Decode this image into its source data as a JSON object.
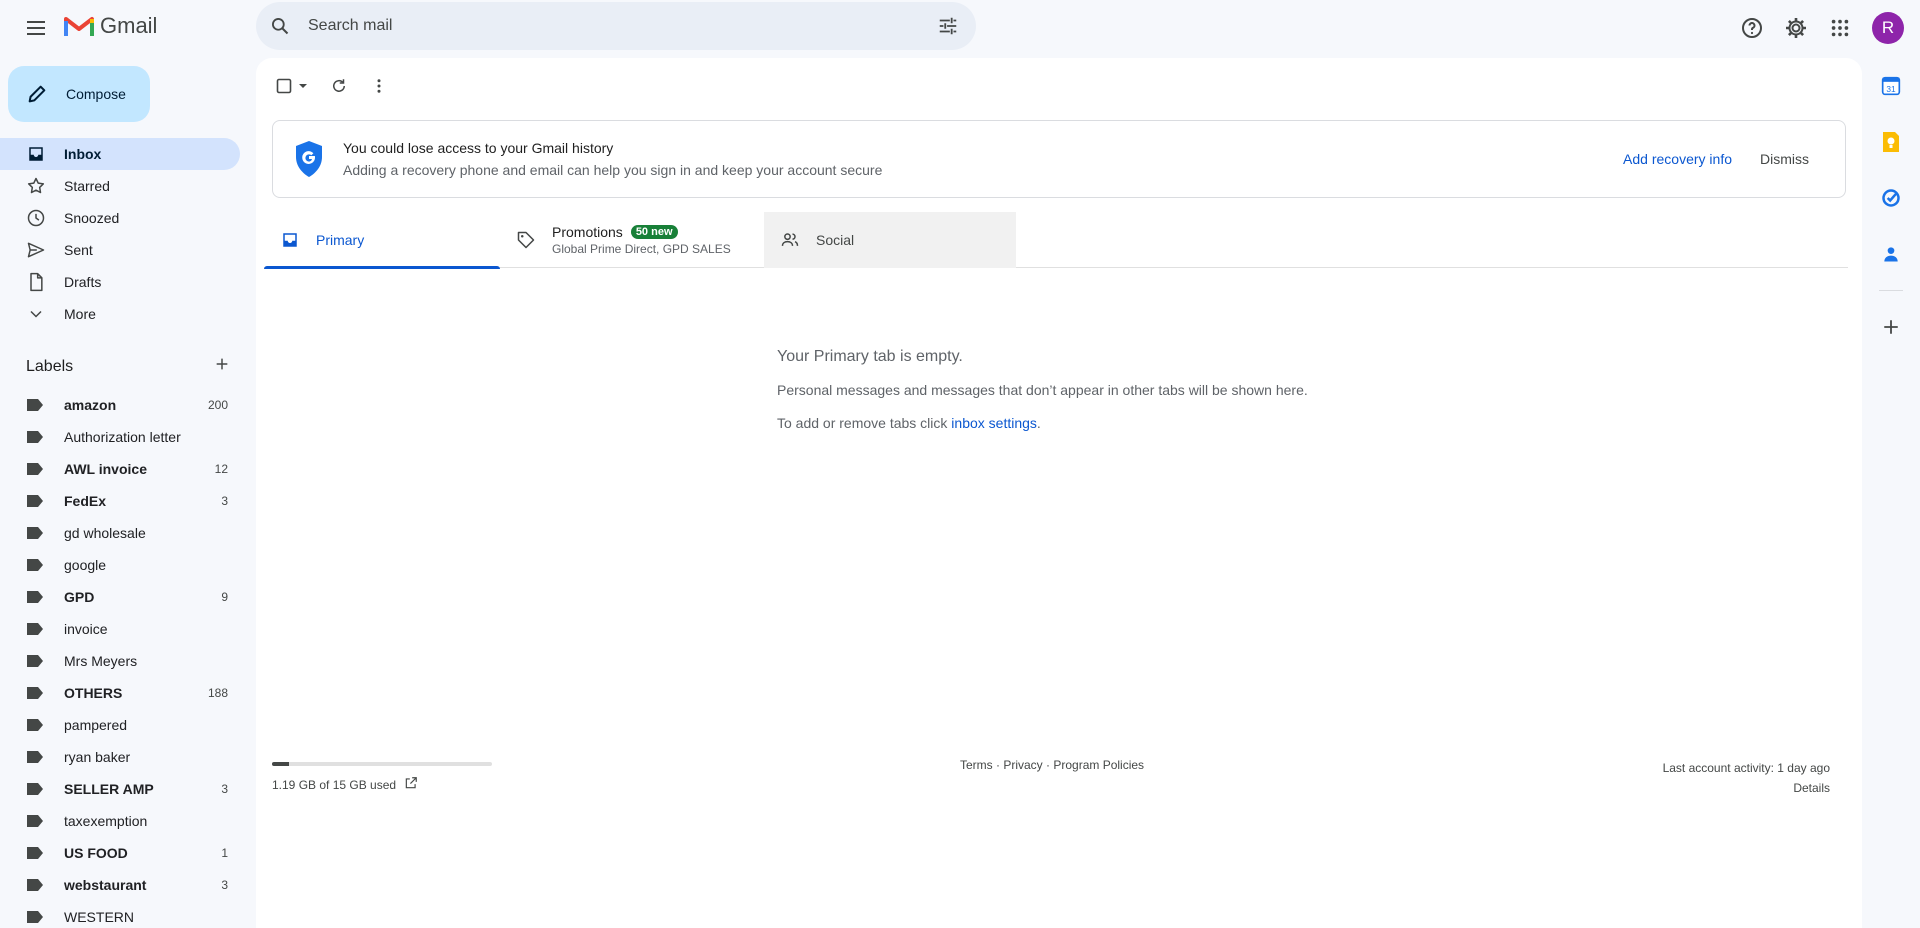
{
  "app": {
    "logo_text": "Gmail"
  },
  "search": {
    "placeholder": "Search mail"
  },
  "header": {
    "avatar_letter": "R"
  },
  "compose": {
    "label": "Compose"
  },
  "nav": {
    "items": [
      {
        "label": "Inbox",
        "icon": "inbox-icon",
        "active": true
      },
      {
        "label": "Starred",
        "icon": "star-icon"
      },
      {
        "label": "Snoozed",
        "icon": "clock-icon"
      },
      {
        "label": "Sent",
        "icon": "send-icon"
      },
      {
        "label": "Drafts",
        "icon": "draft-icon"
      },
      {
        "label": "More",
        "icon": "chevron-down-icon"
      }
    ]
  },
  "labels": {
    "title": "Labels",
    "items": [
      {
        "name": "amazon",
        "count": "200",
        "bold": true
      },
      {
        "name": "Authorization letter",
        "count": "",
        "bold": false
      },
      {
        "name": "AWL invoice",
        "count": "12",
        "bold": true
      },
      {
        "name": "FedEx",
        "count": "3",
        "bold": true
      },
      {
        "name": "gd wholesale",
        "count": "",
        "bold": false
      },
      {
        "name": "google",
        "count": "",
        "bold": false
      },
      {
        "name": "GPD",
        "count": "9",
        "bold": true
      },
      {
        "name": "invoice",
        "count": "",
        "bold": false
      },
      {
        "name": "Mrs Meyers",
        "count": "",
        "bold": false
      },
      {
        "name": "OTHERS",
        "count": "188",
        "bold": true
      },
      {
        "name": "pampered",
        "count": "",
        "bold": false
      },
      {
        "name": "ryan baker",
        "count": "",
        "bold": false
      },
      {
        "name": "SELLER AMP",
        "count": "3",
        "bold": true
      },
      {
        "name": "taxexemption",
        "count": "",
        "bold": false
      },
      {
        "name": "US FOOD",
        "count": "1",
        "bold": true
      },
      {
        "name": "webstaurant",
        "count": "3",
        "bold": true
      },
      {
        "name": "WESTERN",
        "count": "",
        "bold": false
      }
    ]
  },
  "banner": {
    "title": "You could lose access to your Gmail history",
    "subtitle": "Adding a recovery phone and email can help you sign in and keep your account secure",
    "add_label": "Add recovery info",
    "dismiss_label": "Dismiss"
  },
  "tabs": {
    "primary": "Primary",
    "promotions": "Promotions",
    "promotions_badge": "50 new",
    "promotions_senders": "Global Prime Direct, GPD SALES",
    "social": "Social"
  },
  "empty": {
    "heading": "Your Primary tab is empty.",
    "body": "Personal messages and messages that don’t appear in other tabs will be shown here.",
    "settings_prefix": "To add or remove tabs click ",
    "settings_link": "inbox settings",
    "settings_suffix": "."
  },
  "footer": {
    "storage_text": "1.19 GB of 15 GB used",
    "storage_fraction": 0.079,
    "terms": "Terms",
    "sep": " · ",
    "privacy": "Privacy",
    "policies": "Program Policies",
    "last_activity": "Last account activity: 1 day ago",
    "details": "Details"
  },
  "colors": {
    "accent": "#0b57d0",
    "compose_bg": "#c2e7ff",
    "active_nav": "#d3e3fd",
    "badge": "#188038",
    "avatar": "#8e24aa"
  }
}
